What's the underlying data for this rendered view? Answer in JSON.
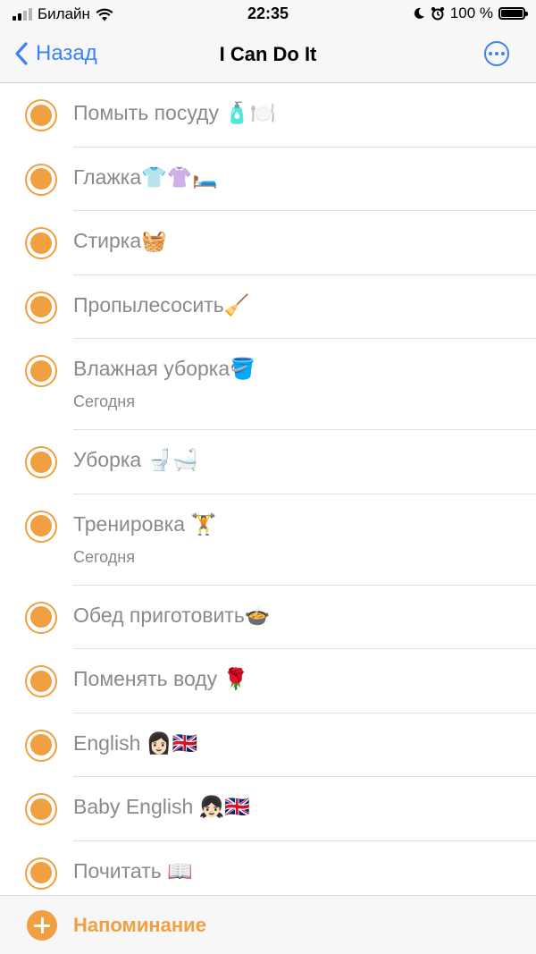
{
  "status_bar": {
    "carrier": "Билайн",
    "time": "22:35",
    "battery_text": "100 %",
    "battery_level": 1.0
  },
  "nav": {
    "back_label": "Назад",
    "title": "I Can Do It"
  },
  "reminders": [
    {
      "title": "Помыть посуду 🧴🍽️",
      "subtitle": ""
    },
    {
      "title": "Глажка👕👚🛏️",
      "subtitle": ""
    },
    {
      "title": "Стирка🧺",
      "subtitle": ""
    },
    {
      "title": "Пропылесосить🧹",
      "subtitle": ""
    },
    {
      "title": "Влажная уборка🪣",
      "subtitle": "Сегодня"
    },
    {
      "title": "Уборка 🚽🛁",
      "subtitle": ""
    },
    {
      "title": "Тренировка 🏋️",
      "subtitle": "Сегодня"
    },
    {
      "title": "Обед приготовить🍲",
      "subtitle": ""
    },
    {
      "title": "Поменять воду 🌹",
      "subtitle": ""
    },
    {
      "title": "English 👩🏻🇬🇧",
      "subtitle": ""
    },
    {
      "title": "Baby English 👧🏻🇬🇧",
      "subtitle": ""
    },
    {
      "title": "Почитать 📖",
      "subtitle": ""
    }
  ],
  "toolbar": {
    "add_label": "Напоминание"
  },
  "colors": {
    "accent": "#f0a040",
    "link": "#3a82f7",
    "text_secondary": "#8a8a8a"
  },
  "icons": {
    "back": "chevron-left-icon",
    "more": "ellipsis-circle-icon",
    "add": "plus-circle-icon",
    "reminder": "circle-checkbox-icon"
  }
}
